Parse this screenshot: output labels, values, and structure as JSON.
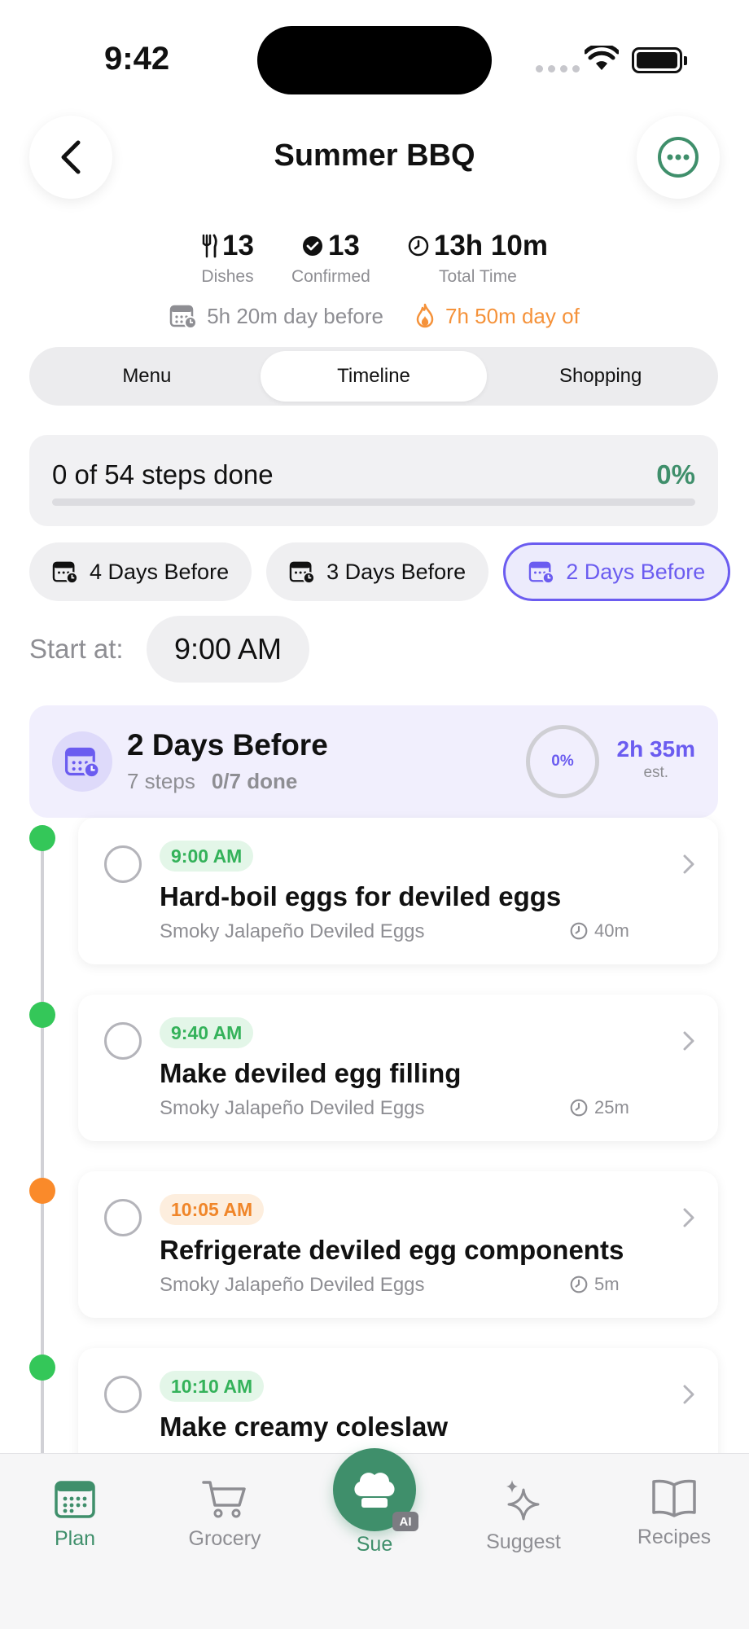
{
  "status_bar": {
    "time": "9:42"
  },
  "header": {
    "title": "Summer BBQ"
  },
  "stats": [
    {
      "icon": "utensils-icon",
      "value": "13",
      "label": "Dishes"
    },
    {
      "icon": "checkmark-circle-icon",
      "value": "13",
      "label": "Confirmed"
    },
    {
      "icon": "clock-icon",
      "value": "13h 10m",
      "label": "Total Time"
    }
  ],
  "subtimes": {
    "day_before": "5h 20m day before",
    "day_of": "7h 50m day of"
  },
  "tabs": [
    {
      "label": "Menu",
      "active": false
    },
    {
      "label": "Timeline",
      "active": true
    },
    {
      "label": "Shopping",
      "active": false
    }
  ],
  "progress": {
    "text": "0 of 54 steps done",
    "percent_label": "0%",
    "fraction": 0
  },
  "day_chips": [
    {
      "label": "4 Days Before",
      "active": false
    },
    {
      "label": "3 Days Before",
      "active": false
    },
    {
      "label": "2 Days Before",
      "active": true
    }
  ],
  "start_at": {
    "label": "Start at:",
    "value": "9:00 AM"
  },
  "day_section": {
    "title": "2 Days Before",
    "steps": "7 steps",
    "done": "0/7 done",
    "ring_percent": "0%",
    "est_time": "2h 35m",
    "est_label": "est."
  },
  "steps": [
    {
      "time": "9:00 AM",
      "color": "green",
      "title": "Hard-boil eggs for deviled eggs",
      "recipe": "Smoky Jalapeño Deviled Eggs",
      "duration": "40m"
    },
    {
      "time": "9:40 AM",
      "color": "green",
      "title": "Make deviled egg filling",
      "recipe": "Smoky Jalapeño Deviled Eggs",
      "duration": "25m"
    },
    {
      "time": "10:05 AM",
      "color": "orange",
      "title": "Refrigerate deviled egg components",
      "recipe": "Smoky Jalapeño Deviled Eggs",
      "duration": "5m"
    },
    {
      "time": "10:10 AM",
      "color": "green",
      "title": "Make creamy coleslaw",
      "recipe": "",
      "duration": ""
    }
  ],
  "tabbar": {
    "plan": "Plan",
    "grocery": "Grocery",
    "sue": "Sue",
    "ai_badge": "AI",
    "suggest": "Suggest",
    "recipes": "Recipes"
  },
  "colors": {
    "brand_green": "#3f8f6b",
    "accent_purple": "#6b5cf0",
    "status_green": "#34c759",
    "status_orange": "#fa8a2a"
  }
}
